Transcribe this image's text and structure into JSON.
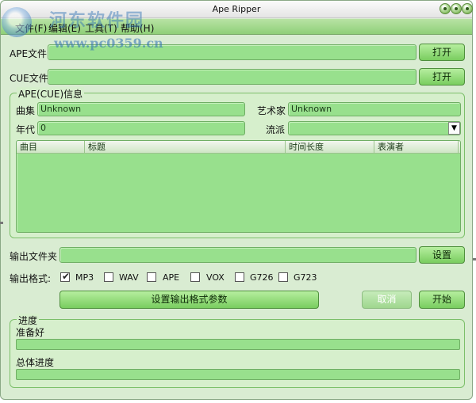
{
  "window": {
    "title": "Ape Ripper"
  },
  "watermark": {
    "text": "河东软件园",
    "url": "www.pc0359.cn"
  },
  "menu": [
    {
      "label": "文件(F)"
    },
    {
      "label": "编辑(E)"
    },
    {
      "label": "工具(T)"
    },
    {
      "label": "帮助(H)"
    }
  ],
  "ape_file": {
    "label": "APE文件",
    "value": "",
    "button": "打开"
  },
  "cue_file": {
    "label": "CUE文件",
    "value": "",
    "button": "打开"
  },
  "info": {
    "group_title": "APE(CUE)信息",
    "album_label": "曲集",
    "album_value": "Unknown",
    "artist_label": "艺术家",
    "artist_value": "Unknown",
    "year_label": "年代",
    "year_value": "0",
    "genre_label": "流派",
    "genre_value": ""
  },
  "tracks": {
    "columns": [
      "曲目",
      "标题",
      "时间长度",
      "表演者"
    ],
    "rows": []
  },
  "output_folder": {
    "label": "输出文件夹",
    "value": "",
    "button": "设置"
  },
  "output_format": {
    "label": "输出格式:",
    "options": [
      {
        "label": "MP3",
        "checked": true
      },
      {
        "label": "WAV",
        "checked": false
      },
      {
        "label": "APE",
        "checked": false
      },
      {
        "label": "VOX",
        "checked": false
      },
      {
        "label": "G726",
        "checked": false
      },
      {
        "label": "G723",
        "checked": false
      }
    ]
  },
  "actions": {
    "format_params": "设置输出格式参数",
    "cancel": "取消",
    "start": "开始"
  },
  "progress": {
    "group_title": "进度",
    "status": "准备好",
    "status_progress": 0,
    "total_label": "总体进度",
    "total_progress": 0
  },
  "colors": {
    "accent": "#98e08d",
    "button": "#79cd5f",
    "panel": "#d6efcc"
  }
}
